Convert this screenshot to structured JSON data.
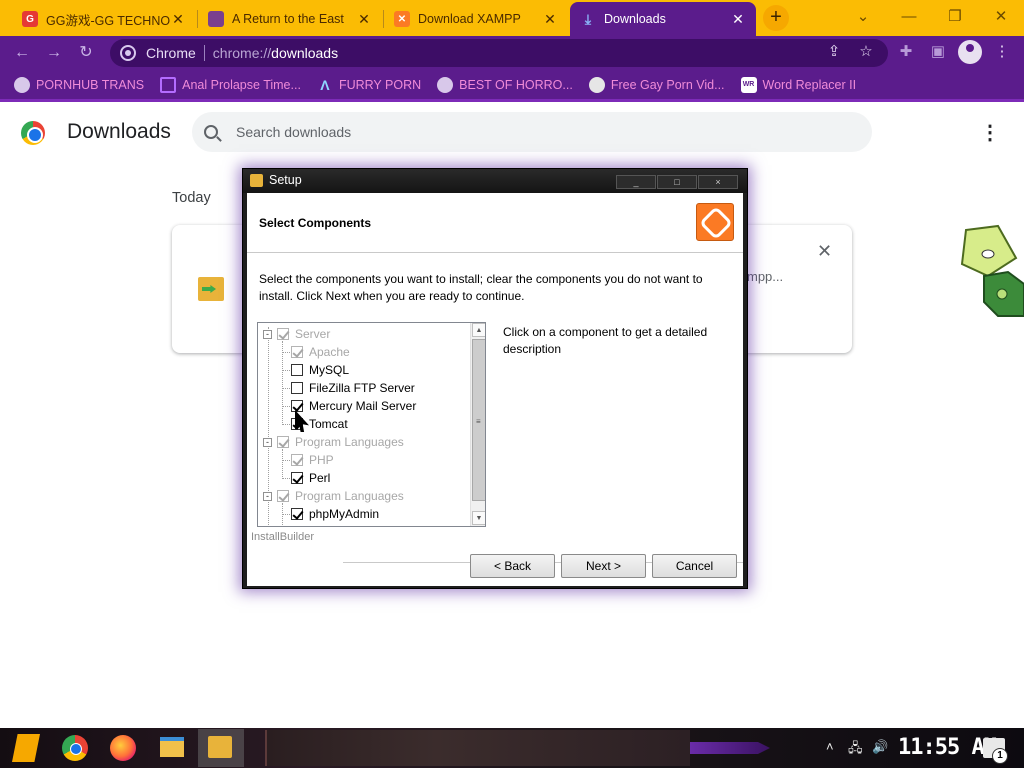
{
  "browser": {
    "tabs": [
      {
        "title": "GG游戏-GG TECHNO",
        "active": false
      },
      {
        "title": "A Return to the East",
        "active": false
      },
      {
        "title": "Download XAMPP",
        "active": false
      },
      {
        "title": "Downloads",
        "active": true
      }
    ],
    "new_tab_label": "+",
    "omnibox": {
      "chrome_label": "Chrome",
      "url_scheme": "chrome://",
      "url_host": "downloads"
    },
    "bookmarks": [
      {
        "label": "PORNHUB TRANS",
        "icon": "globe-icon"
      },
      {
        "label": "Anal Prolapse Time...",
        "icon": "bookmark-page-icon"
      },
      {
        "label": "FURRY PORN",
        "icon": "triangle-logo-icon"
      },
      {
        "label": "BEST OF HORRO...",
        "icon": "globe-icon"
      },
      {
        "label": "Free Gay Porn Vid...",
        "icon": "site-logo-icon"
      },
      {
        "label": "Word Replacer II",
        "icon": "wr-extension-icon",
        "badge": "WR"
      }
    ],
    "colors": {
      "tab_strip": "#fbbc04",
      "toolbar": "#5b1c8c",
      "bookmark_text": "#f08bd8"
    }
  },
  "downloads_page": {
    "title": "Downloads",
    "search_placeholder": "Search downloads",
    "section": "Today",
    "card_text_fragment": "mpp..."
  },
  "setup_dialog": {
    "title": "Setup",
    "heading": "Select Components",
    "description": "Select the components you want to install; clear the components you do not want to install. Click Next when you are ready to continue.",
    "hint": "Click on a component to get a detailed description",
    "installer_brand": "InstallBuilder",
    "components": [
      {
        "label": "Server",
        "level": 0,
        "checked": true,
        "disabled": true,
        "expander": "-"
      },
      {
        "label": "Apache",
        "level": 1,
        "checked": true,
        "disabled": true
      },
      {
        "label": "MySQL",
        "level": 1,
        "checked": false,
        "disabled": false
      },
      {
        "label": "FileZilla FTP Server",
        "level": 1,
        "checked": false,
        "disabled": false
      },
      {
        "label": "Mercury Mail Server",
        "level": 1,
        "checked": true,
        "disabled": false
      },
      {
        "label": "Tomcat",
        "level": 1,
        "checked": true,
        "disabled": false
      },
      {
        "label": "Program Languages",
        "level": 0,
        "checked": true,
        "disabled": true,
        "expander": "-"
      },
      {
        "label": "PHP",
        "level": 1,
        "checked": true,
        "disabled": true
      },
      {
        "label": "Perl",
        "level": 1,
        "checked": true,
        "disabled": false
      },
      {
        "label": "Program Languages",
        "level": 0,
        "checked": true,
        "disabled": true,
        "expander": "-"
      },
      {
        "label": "phpMyAdmin",
        "level": 1,
        "checked": true,
        "disabled": false
      }
    ],
    "buttons": {
      "back": "< Back",
      "next": "Next >",
      "cancel": "Cancel"
    },
    "window_controls": {
      "minimize": "_",
      "maximize": "□",
      "close": "×"
    }
  },
  "taskbar": {
    "clock": "11:55 AM",
    "notification_count": "1",
    "apps": [
      "start-icon",
      "chrome-icon",
      "firefox-icon",
      "file-explorer-icon",
      "setup-icon"
    ]
  }
}
